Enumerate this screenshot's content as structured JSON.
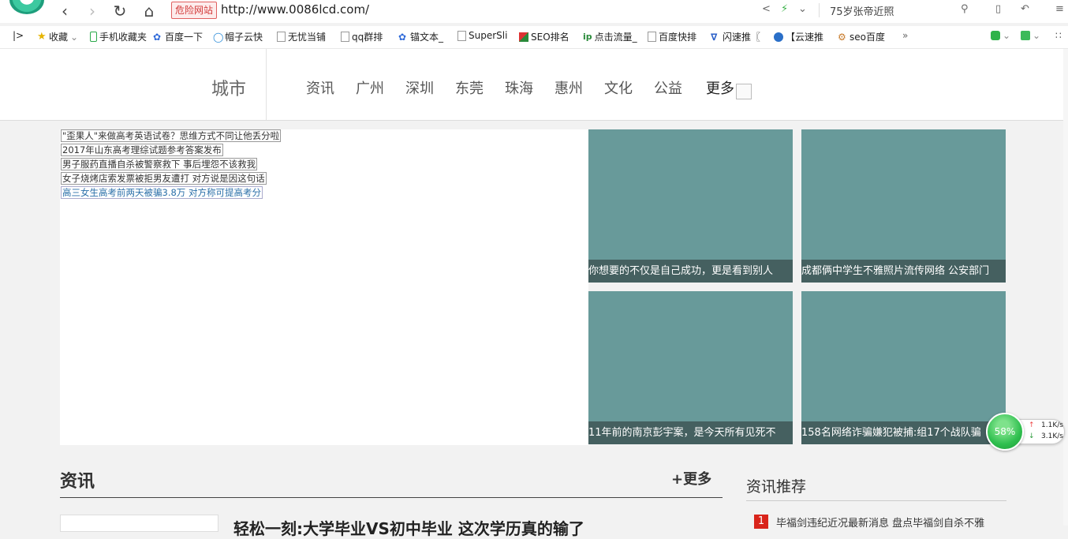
{
  "browser": {
    "danger_label": "危险网站",
    "url": "http://www.0086lcd.com/",
    "search_text": "75岁张帝近照"
  },
  "bookmarks": [
    {
      "label": "收藏",
      "icon": "star-icon"
    },
    {
      "label": "手机收藏夹",
      "icon": "phone-icon"
    },
    {
      "label": "百度一下",
      "icon": "baidu-paw-icon"
    },
    {
      "label": "帽子云快",
      "icon": "drop-icon"
    },
    {
      "label": "无忧当铺",
      "icon": "page-icon"
    },
    {
      "label": "qq群排",
      "icon": "page-icon"
    },
    {
      "label": "锚文本_",
      "icon": "baidu-paw-icon"
    },
    {
      "label": "SuperSli",
      "icon": "page-icon"
    },
    {
      "label": "SEO排名",
      "icon": "seo-icon"
    },
    {
      "label": "点击流量_",
      "icon": "ip-icon"
    },
    {
      "label": "百度快排",
      "icon": "page-icon"
    },
    {
      "label": "闪速推〖",
      "icon": "flash-icon"
    },
    {
      "label": "【云速推",
      "icon": "cloud-icon"
    },
    {
      "label": "seo百度",
      "icon": "gear-icon"
    }
  ],
  "site": {
    "brand": "城市",
    "nav": [
      "资讯",
      "广州",
      "深圳",
      "东莞",
      "珠海",
      "惠州",
      "文化",
      "公益"
    ],
    "nav_more": "更多"
  },
  "headlines": [
    "\"歪果人\"来做高考英语试卷？思维方式不同让他丢分啦",
    "2017年山东高考理综试题参考答案发布",
    "男子服药直播自杀被警察救下 事后埋怨不该救我",
    "女子烧烤店索发票被拒男友遭打 对方说是因这句话",
    "高三女生高考前两天被骗3.8万 对方称可提高考分"
  ],
  "tiles": [
    {
      "caption": "你想要的不仅是自己成功，更是看到别人"
    },
    {
      "caption": "成都俩中学生不雅照片流传网络 公安部门"
    },
    {
      "caption": "11年前的南京彭宇案，是今天所有见死不"
    },
    {
      "caption": "158名网络诈骗嫌犯被捕:组17个战队骗"
    }
  ],
  "speed_widget": {
    "percent": "58%",
    "upload": "1.1K/s",
    "download": "3.1K/s"
  },
  "news_section": {
    "title": "资讯",
    "more": "+更多",
    "lead_title": "轻松一刻:大学毕业VS初中毕业 这次学历真的输了"
  },
  "recommend": {
    "title": "资讯推荐",
    "items": [
      {
        "rank": "1",
        "text": "毕福剑违纪近况最新消息 盘点毕福剑自杀不雅"
      }
    ]
  }
}
